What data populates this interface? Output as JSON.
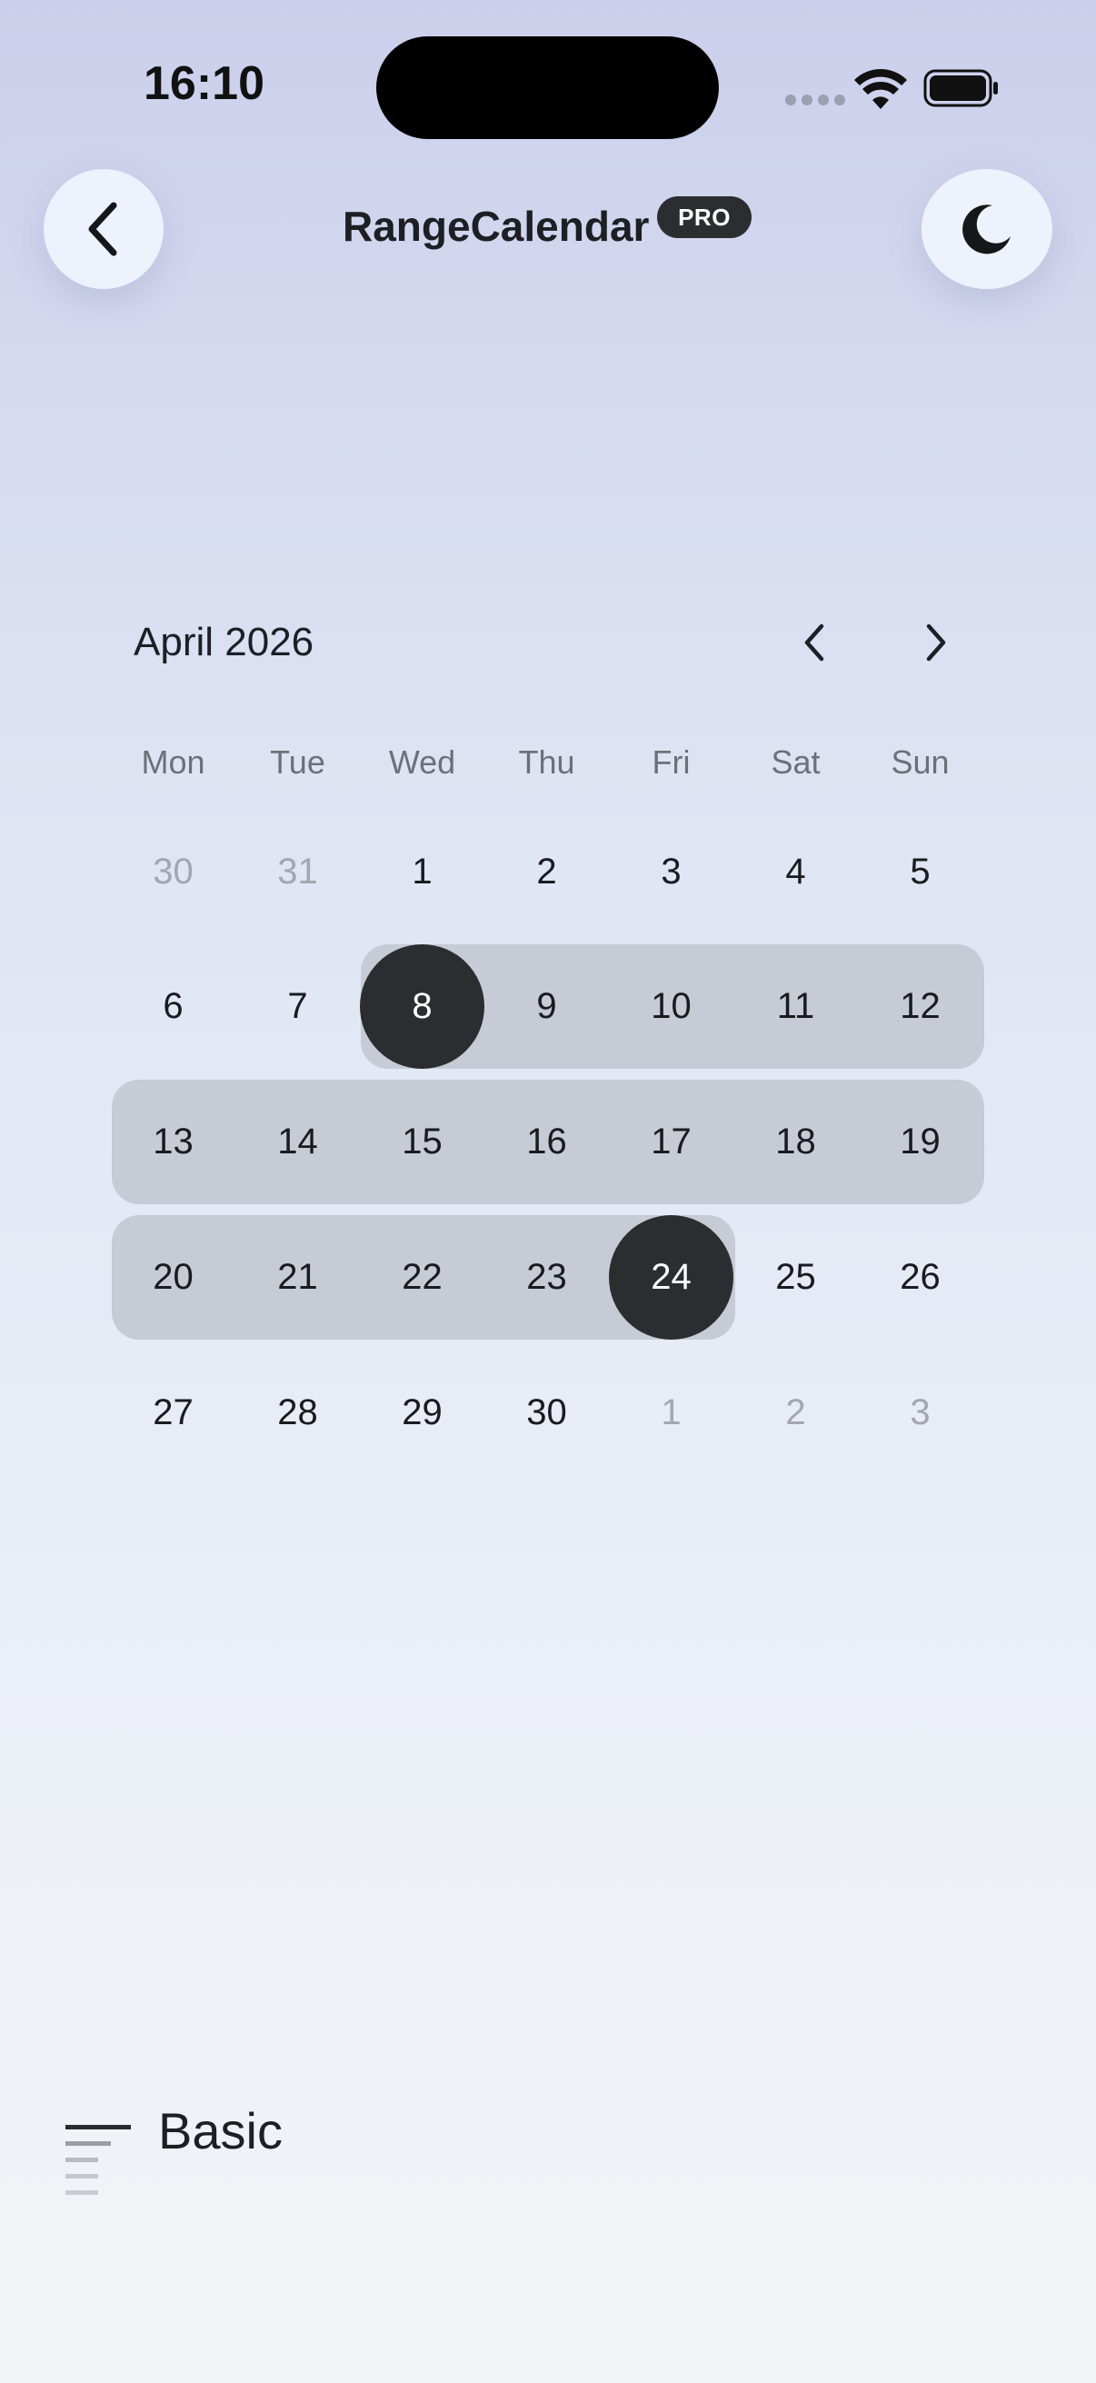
{
  "status_bar": {
    "time": "16:10"
  },
  "header": {
    "title": "RangeCalendar",
    "badge": "PRO"
  },
  "calendar": {
    "month": "April 2026",
    "weekdays": [
      "Mon",
      "Tue",
      "Wed",
      "Thu",
      "Fri",
      "Sat",
      "Sun"
    ],
    "weeks": [
      [
        {
          "d": "30",
          "m": true
        },
        {
          "d": "31",
          "m": true
        },
        {
          "d": "1"
        },
        {
          "d": "2"
        },
        {
          "d": "3"
        },
        {
          "d": "4"
        },
        {
          "d": "5"
        }
      ],
      [
        {
          "d": "6"
        },
        {
          "d": "7"
        },
        {
          "d": "8",
          "s": true
        },
        {
          "d": "9"
        },
        {
          "d": "10"
        },
        {
          "d": "11"
        },
        {
          "d": "12"
        }
      ],
      [
        {
          "d": "13"
        },
        {
          "d": "14"
        },
        {
          "d": "15"
        },
        {
          "d": "16"
        },
        {
          "d": "17"
        },
        {
          "d": "18"
        },
        {
          "d": "19"
        }
      ],
      [
        {
          "d": "20"
        },
        {
          "d": "21"
        },
        {
          "d": "22"
        },
        {
          "d": "23"
        },
        {
          "d": "24",
          "s": true
        },
        {
          "d": "25"
        },
        {
          "d": "26"
        }
      ],
      [
        {
          "d": "27"
        },
        {
          "d": "28"
        },
        {
          "d": "29"
        },
        {
          "d": "30"
        },
        {
          "d": "1",
          "m": true
        },
        {
          "d": "2",
          "m": true
        },
        {
          "d": "3",
          "m": true
        }
      ]
    ],
    "range_start": "8",
    "range_end": "24"
  },
  "footer": {
    "label": "Basic"
  },
  "icons": {
    "back": "chevron-left-icon",
    "theme": "moon-icon",
    "prev": "chevron-left-icon",
    "next": "chevron-right-icon",
    "menu": "menu-lines-icon"
  },
  "colors": {
    "selected": "#2b2d31",
    "range": "#c6cbd5"
  }
}
